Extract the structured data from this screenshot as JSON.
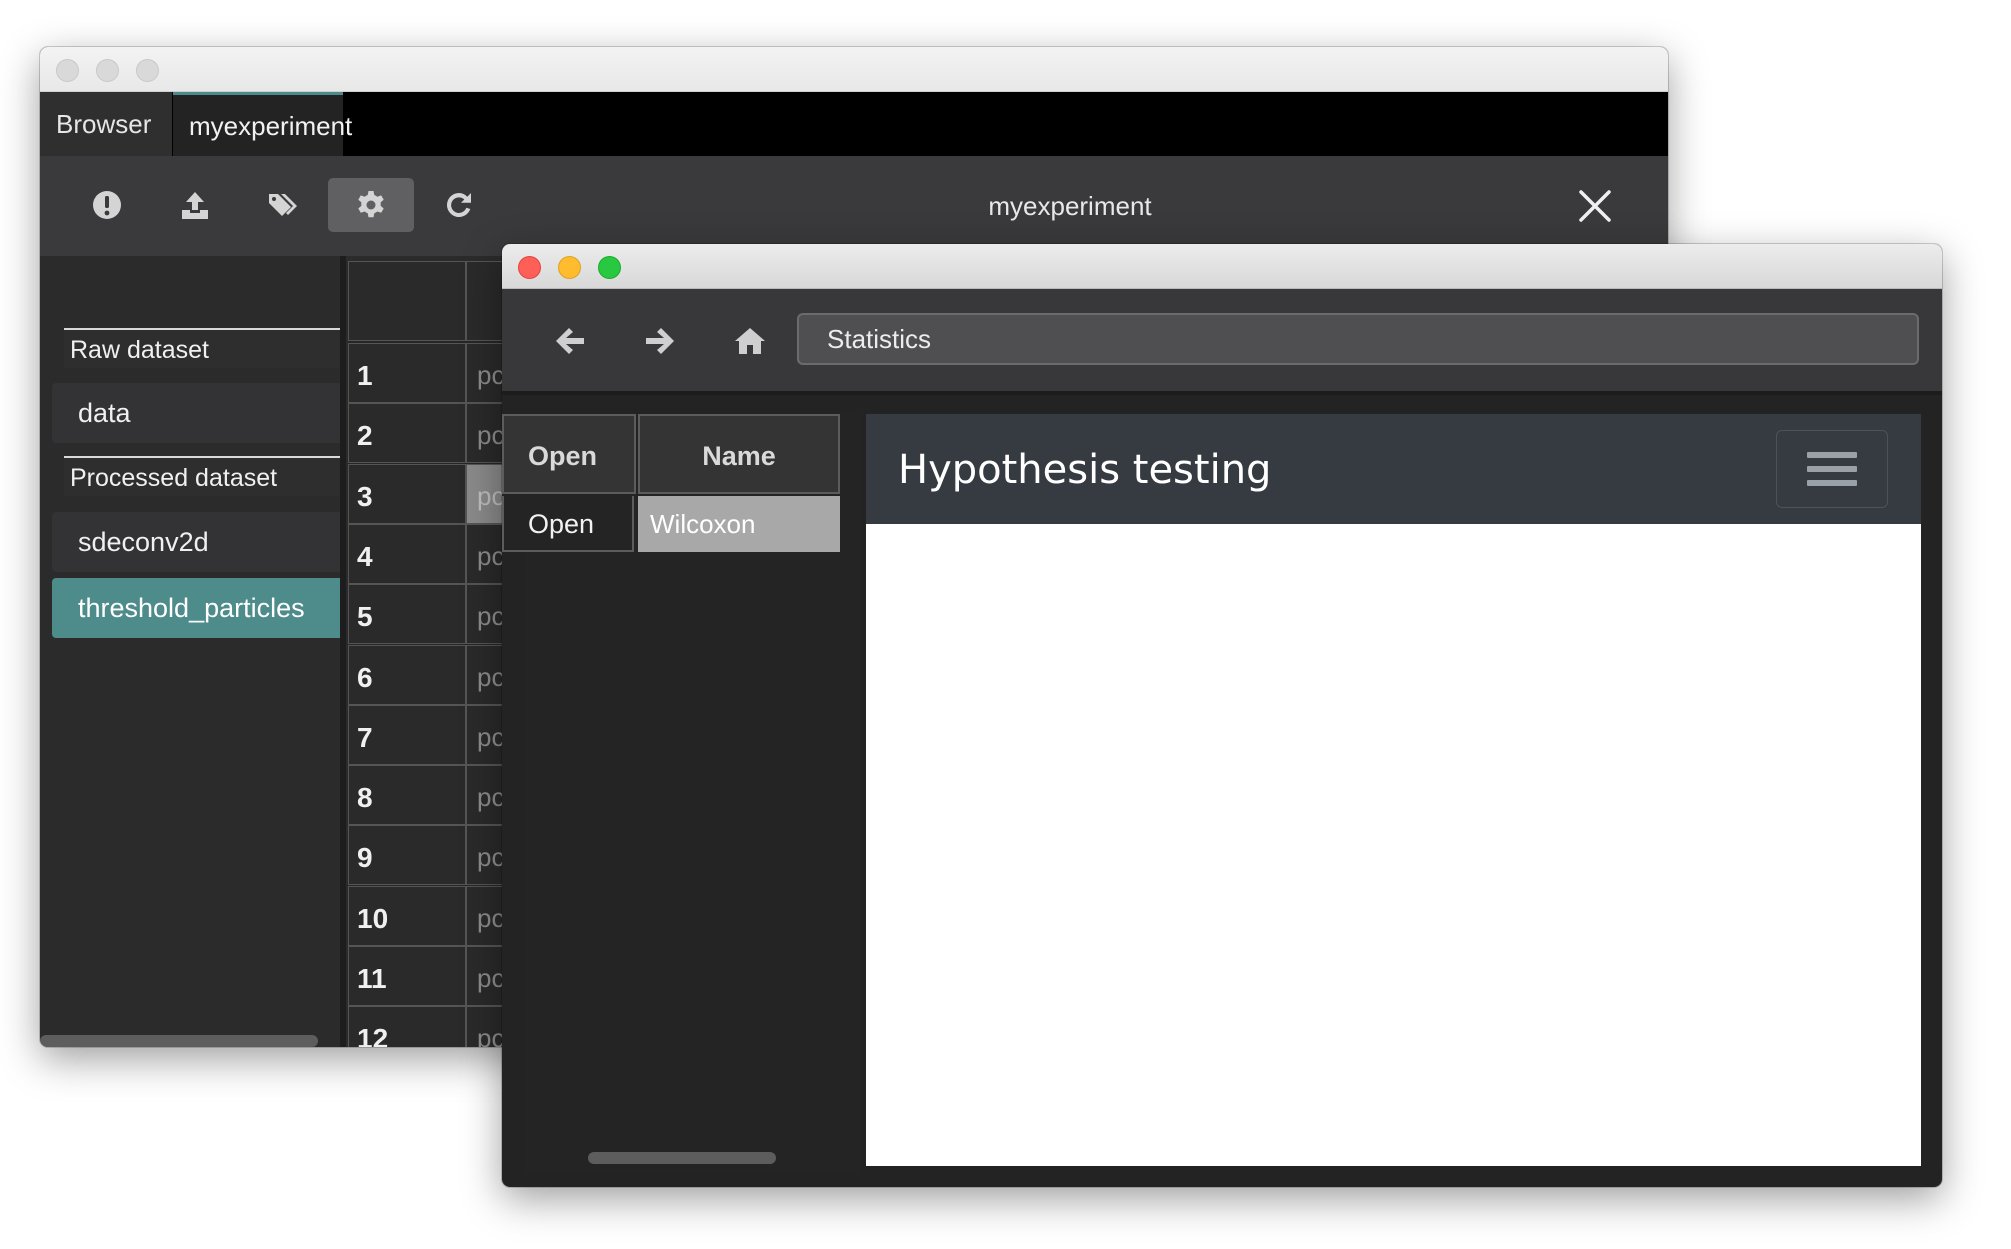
{
  "back_window": {
    "tabs": [
      {
        "label": "Browser"
      },
      {
        "label": "myexperiment"
      }
    ],
    "toolbar": {
      "title": "myexperiment",
      "buttons": [
        {
          "icon": "exclamation-icon"
        },
        {
          "icon": "upload-icon"
        },
        {
          "icon": "tags-icon"
        },
        {
          "icon": "gear-icon",
          "active": true
        },
        {
          "icon": "refresh-icon"
        }
      ]
    },
    "sidebar": {
      "sections": [
        {
          "header": "Raw dataset",
          "items": [
            "data"
          ]
        },
        {
          "header": "Processed dataset",
          "items": [
            "sdeconv2d",
            "threshold_particles"
          ]
        }
      ],
      "selected": "threshold_particles"
    },
    "grid": {
      "rows": [
        "1",
        "2",
        "3",
        "4",
        "5",
        "6",
        "7",
        "8",
        "9",
        "10",
        "11",
        "12"
      ],
      "cell_prefix": "pc",
      "highlighted_row": "3"
    }
  },
  "front_window": {
    "url": "Statistics",
    "table": {
      "headers": [
        "Open",
        "Name"
      ],
      "rows": [
        {
          "open": "Open",
          "name": "Wilcoxon"
        }
      ]
    },
    "content": {
      "title": "Hypothesis testing"
    }
  },
  "colors": {
    "accent": "#4e8b8b",
    "content_header": "#363b42"
  }
}
